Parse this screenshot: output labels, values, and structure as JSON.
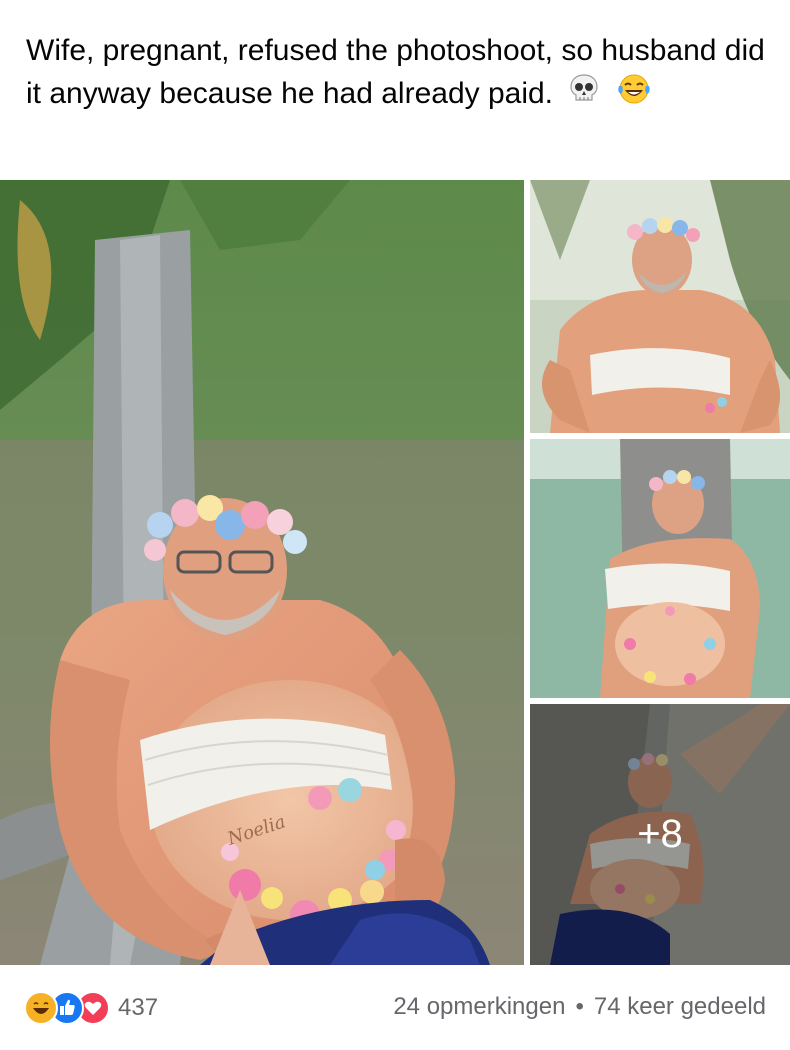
{
  "post": {
    "text": "Wife, pregnant, refused the photoshoot, so husband did it anyway because he had already paid.",
    "emojis": [
      "skull-emoji",
      "laughing-tears-emoji"
    ]
  },
  "gallery": {
    "more_count_label": "+8",
    "belly_text": "Noelia"
  },
  "footer": {
    "reaction_icons": [
      "haha-reaction",
      "like-reaction",
      "love-reaction"
    ],
    "reaction_count": "437",
    "comments": "24 opmerkingen",
    "separator": "•",
    "shares": "74 keer gedeeld"
  },
  "colors": {
    "like_blue": "#1877f2",
    "love_red": "#f33e58",
    "haha_yellow": "#f7b125",
    "meta_gray": "#65676b"
  }
}
